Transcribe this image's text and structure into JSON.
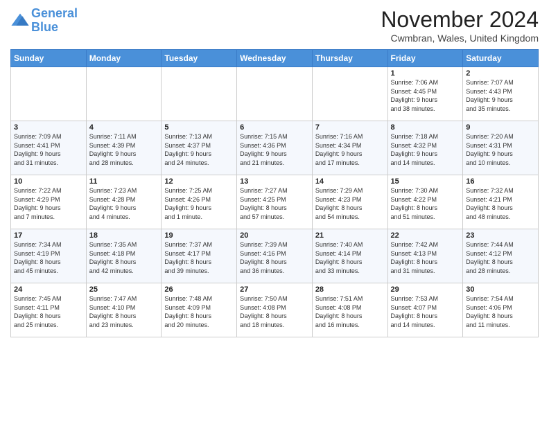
{
  "header": {
    "logo_line1": "General",
    "logo_line2": "Blue",
    "month_title": "November 2024",
    "location": "Cwmbran, Wales, United Kingdom"
  },
  "days_of_week": [
    "Sunday",
    "Monday",
    "Tuesday",
    "Wednesday",
    "Thursday",
    "Friday",
    "Saturday"
  ],
  "weeks": [
    [
      {
        "day": "",
        "info": ""
      },
      {
        "day": "",
        "info": ""
      },
      {
        "day": "",
        "info": ""
      },
      {
        "day": "",
        "info": ""
      },
      {
        "day": "",
        "info": ""
      },
      {
        "day": "1",
        "info": "Sunrise: 7:06 AM\nSunset: 4:45 PM\nDaylight: 9 hours\nand 38 minutes."
      },
      {
        "day": "2",
        "info": "Sunrise: 7:07 AM\nSunset: 4:43 PM\nDaylight: 9 hours\nand 35 minutes."
      }
    ],
    [
      {
        "day": "3",
        "info": "Sunrise: 7:09 AM\nSunset: 4:41 PM\nDaylight: 9 hours\nand 31 minutes."
      },
      {
        "day": "4",
        "info": "Sunrise: 7:11 AM\nSunset: 4:39 PM\nDaylight: 9 hours\nand 28 minutes."
      },
      {
        "day": "5",
        "info": "Sunrise: 7:13 AM\nSunset: 4:37 PM\nDaylight: 9 hours\nand 24 minutes."
      },
      {
        "day": "6",
        "info": "Sunrise: 7:15 AM\nSunset: 4:36 PM\nDaylight: 9 hours\nand 21 minutes."
      },
      {
        "day": "7",
        "info": "Sunrise: 7:16 AM\nSunset: 4:34 PM\nDaylight: 9 hours\nand 17 minutes."
      },
      {
        "day": "8",
        "info": "Sunrise: 7:18 AM\nSunset: 4:32 PM\nDaylight: 9 hours\nand 14 minutes."
      },
      {
        "day": "9",
        "info": "Sunrise: 7:20 AM\nSunset: 4:31 PM\nDaylight: 9 hours\nand 10 minutes."
      }
    ],
    [
      {
        "day": "10",
        "info": "Sunrise: 7:22 AM\nSunset: 4:29 PM\nDaylight: 9 hours\nand 7 minutes."
      },
      {
        "day": "11",
        "info": "Sunrise: 7:23 AM\nSunset: 4:28 PM\nDaylight: 9 hours\nand 4 minutes."
      },
      {
        "day": "12",
        "info": "Sunrise: 7:25 AM\nSunset: 4:26 PM\nDaylight: 9 hours\nand 1 minute."
      },
      {
        "day": "13",
        "info": "Sunrise: 7:27 AM\nSunset: 4:25 PM\nDaylight: 8 hours\nand 57 minutes."
      },
      {
        "day": "14",
        "info": "Sunrise: 7:29 AM\nSunset: 4:23 PM\nDaylight: 8 hours\nand 54 minutes."
      },
      {
        "day": "15",
        "info": "Sunrise: 7:30 AM\nSunset: 4:22 PM\nDaylight: 8 hours\nand 51 minutes."
      },
      {
        "day": "16",
        "info": "Sunrise: 7:32 AM\nSunset: 4:21 PM\nDaylight: 8 hours\nand 48 minutes."
      }
    ],
    [
      {
        "day": "17",
        "info": "Sunrise: 7:34 AM\nSunset: 4:19 PM\nDaylight: 8 hours\nand 45 minutes."
      },
      {
        "day": "18",
        "info": "Sunrise: 7:35 AM\nSunset: 4:18 PM\nDaylight: 8 hours\nand 42 minutes."
      },
      {
        "day": "19",
        "info": "Sunrise: 7:37 AM\nSunset: 4:17 PM\nDaylight: 8 hours\nand 39 minutes."
      },
      {
        "day": "20",
        "info": "Sunrise: 7:39 AM\nSunset: 4:16 PM\nDaylight: 8 hours\nand 36 minutes."
      },
      {
        "day": "21",
        "info": "Sunrise: 7:40 AM\nSunset: 4:14 PM\nDaylight: 8 hours\nand 33 minutes."
      },
      {
        "day": "22",
        "info": "Sunrise: 7:42 AM\nSunset: 4:13 PM\nDaylight: 8 hours\nand 31 minutes."
      },
      {
        "day": "23",
        "info": "Sunrise: 7:44 AM\nSunset: 4:12 PM\nDaylight: 8 hours\nand 28 minutes."
      }
    ],
    [
      {
        "day": "24",
        "info": "Sunrise: 7:45 AM\nSunset: 4:11 PM\nDaylight: 8 hours\nand 25 minutes."
      },
      {
        "day": "25",
        "info": "Sunrise: 7:47 AM\nSunset: 4:10 PM\nDaylight: 8 hours\nand 23 minutes."
      },
      {
        "day": "26",
        "info": "Sunrise: 7:48 AM\nSunset: 4:09 PM\nDaylight: 8 hours\nand 20 minutes."
      },
      {
        "day": "27",
        "info": "Sunrise: 7:50 AM\nSunset: 4:08 PM\nDaylight: 8 hours\nand 18 minutes."
      },
      {
        "day": "28",
        "info": "Sunrise: 7:51 AM\nSunset: 4:08 PM\nDaylight: 8 hours\nand 16 minutes."
      },
      {
        "day": "29",
        "info": "Sunrise: 7:53 AM\nSunset: 4:07 PM\nDaylight: 8 hours\nand 14 minutes."
      },
      {
        "day": "30",
        "info": "Sunrise: 7:54 AM\nSunset: 4:06 PM\nDaylight: 8 hours\nand 11 minutes."
      }
    ]
  ]
}
